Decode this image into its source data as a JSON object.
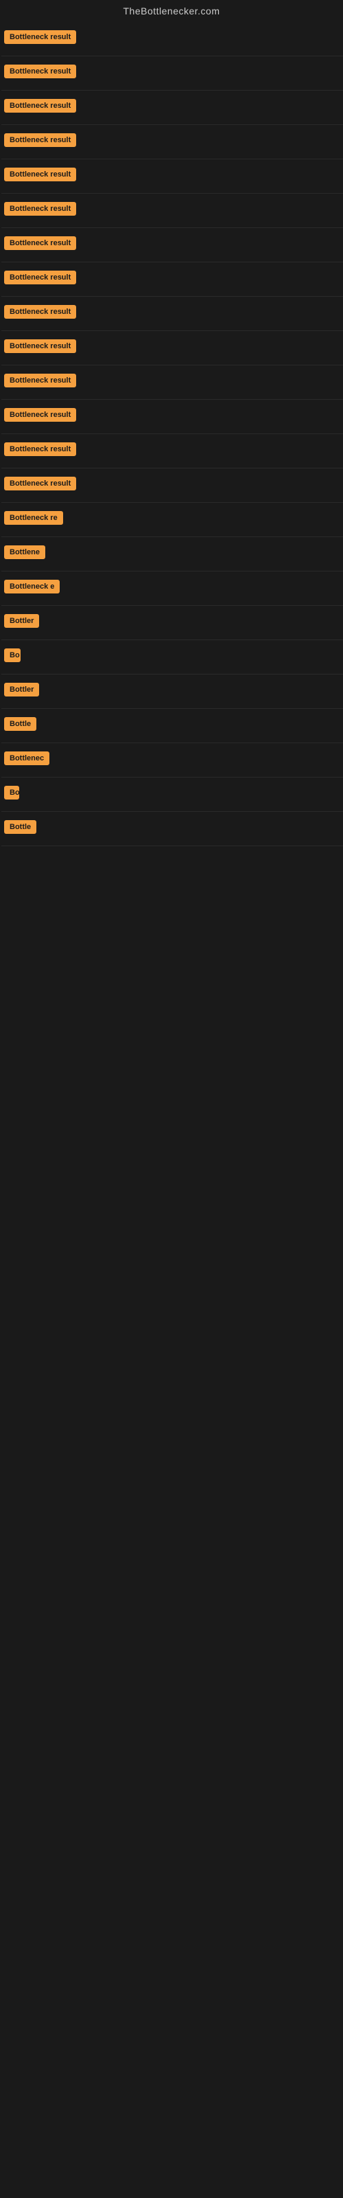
{
  "site": {
    "title": "TheBottlenecker.com"
  },
  "results": [
    {
      "id": 1,
      "label": "Bottleneck result",
      "width": 110
    },
    {
      "id": 2,
      "label": "Bottleneck result",
      "width": 110
    },
    {
      "id": 3,
      "label": "Bottleneck result",
      "width": 110
    },
    {
      "id": 4,
      "label": "Bottleneck result",
      "width": 110
    },
    {
      "id": 5,
      "label": "Bottleneck result",
      "width": 110
    },
    {
      "id": 6,
      "label": "Bottleneck result",
      "width": 110
    },
    {
      "id": 7,
      "label": "Bottleneck result",
      "width": 110
    },
    {
      "id": 8,
      "label": "Bottleneck result",
      "width": 110
    },
    {
      "id": 9,
      "label": "Bottleneck result",
      "width": 110
    },
    {
      "id": 10,
      "label": "Bottleneck result",
      "width": 110
    },
    {
      "id": 11,
      "label": "Bottleneck result",
      "width": 110
    },
    {
      "id": 12,
      "label": "Bottleneck result",
      "width": 110
    },
    {
      "id": 13,
      "label": "Bottleneck result",
      "width": 110
    },
    {
      "id": 14,
      "label": "Bottleneck result",
      "width": 110
    },
    {
      "id": 15,
      "label": "Bottleneck re",
      "width": 90
    },
    {
      "id": 16,
      "label": "Bottlene",
      "width": 68
    },
    {
      "id": 17,
      "label": "Bottleneck e",
      "width": 82
    },
    {
      "id": 18,
      "label": "Bottler",
      "width": 58
    },
    {
      "id": 19,
      "label": "Bo",
      "width": 24
    },
    {
      "id": 20,
      "label": "Bottler",
      "width": 55
    },
    {
      "id": 21,
      "label": "Bottle",
      "width": 48
    },
    {
      "id": 22,
      "label": "Bottlenec",
      "width": 72
    },
    {
      "id": 23,
      "label": "Bo",
      "width": 22
    },
    {
      "id": 24,
      "label": "Bottle",
      "width": 50
    }
  ]
}
